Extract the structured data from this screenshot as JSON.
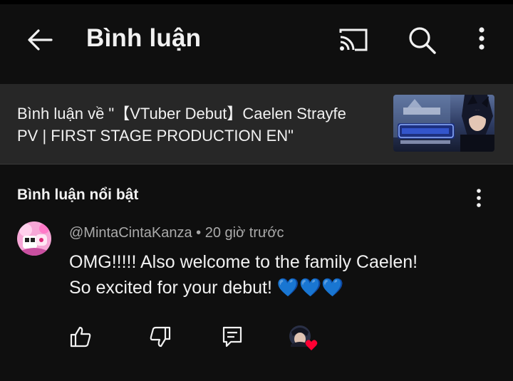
{
  "app": {
    "title": "Bình luận",
    "back_icon": "arrow-left-icon",
    "cast_icon": "cast-icon",
    "search_icon": "search-icon",
    "more_icon": "more-vertical-icon"
  },
  "video": {
    "line1": "Bình luận về \"【VTuber Debut】Caelen Strayfe",
    "line2": "PV | FIRST STAGE PRODUCTION EN\""
  },
  "section": {
    "title": "Bình luận nổi bật"
  },
  "comment": {
    "author": "@MintaCintaKanza",
    "time": "20 giờ trước",
    "separator": "•",
    "line1": "OMG!!!!! Also welcome to the family Caelen!",
    "line2": "So excited for your debut! 💙💙💙",
    "actions": {
      "like_icon": "thumbs-up-icon",
      "dislike_icon": "thumbs-down-icon",
      "reply_icon": "reply-icon",
      "creator_heart_icon": "creator-heart-icon"
    }
  },
  "colors": {
    "background": "#0f0f0f",
    "video_bar": "#272727",
    "secondary_text": "#aaaaaa",
    "heart": "#ff0033"
  }
}
